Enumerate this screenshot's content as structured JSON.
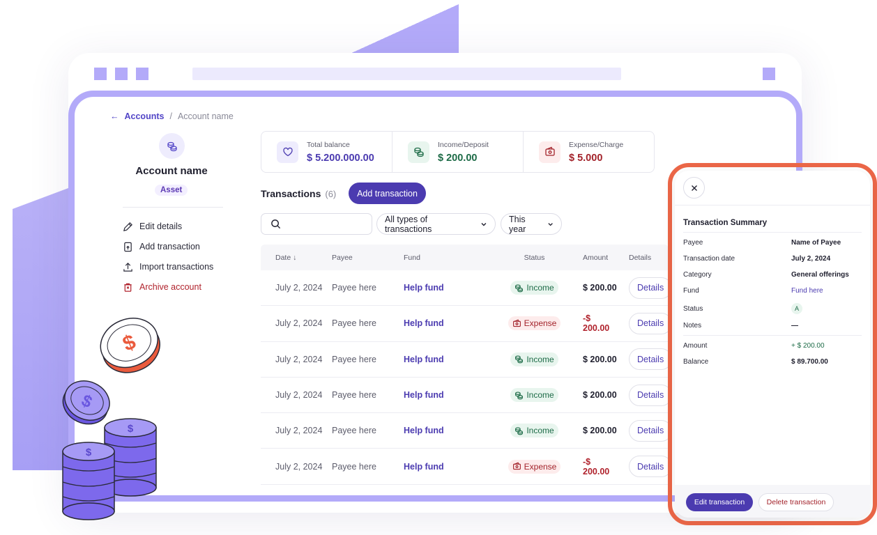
{
  "breadcrumb": {
    "parent": "Accounts",
    "separator": "/",
    "current": "Account name"
  },
  "account": {
    "name": "Account name",
    "type_badge": "Asset",
    "menu": [
      {
        "label": "Edit details",
        "icon": "pencil-icon"
      },
      {
        "label": "Add transaction",
        "icon": "file-plus-icon"
      },
      {
        "label": "Import transactions",
        "icon": "upload-icon"
      },
      {
        "label": "Archive account",
        "icon": "trash-icon"
      }
    ]
  },
  "stats": [
    {
      "label": "Total balance",
      "value": "$ 5.200.000.00",
      "icon": "heart-icon",
      "color": "#4b3bb0"
    },
    {
      "label": "Income/Deposit",
      "value": "$ 200.00",
      "icon": "coins-icon",
      "color": "#1d6b47"
    },
    {
      "label": "Expense/Charge",
      "value": "$ 5.000",
      "icon": "wallet-icon",
      "color": "#a3232b"
    }
  ],
  "transactions": {
    "title": "Transactions",
    "count": "(6)",
    "add_label": "Add transaction",
    "search_placeholder": "",
    "filter_type": "All types of transactions",
    "filter_period": "This year",
    "columns": {
      "date": "Date",
      "payee": "Payee",
      "fund": "Fund",
      "status": "Status",
      "amount": "Amount",
      "details": "Details"
    },
    "rows": [
      {
        "date": "July 2, 2024",
        "payee": "Payee here",
        "fund": "Help fund",
        "status": "Income",
        "amount": "$ 200.00",
        "details": "Details"
      },
      {
        "date": "July 2, 2024",
        "payee": "Payee here",
        "fund": "Help fund",
        "status": "Expense",
        "amount": "-$ 200.00",
        "details": "Details"
      },
      {
        "date": "July 2, 2024",
        "payee": "Payee here",
        "fund": "Help fund",
        "status": "Income",
        "amount": "$ 200.00",
        "details": "Details"
      },
      {
        "date": "July 2, 2024",
        "payee": "Payee here",
        "fund": "Help fund",
        "status": "Income",
        "amount": "$ 200.00",
        "details": "Details"
      },
      {
        "date": "July 2, 2024",
        "payee": "Payee here",
        "fund": "Help fund",
        "status": "Income",
        "amount": "$ 200.00",
        "details": "Details"
      },
      {
        "date": "July 2, 2024",
        "payee": "Payee here",
        "fund": "Help fund",
        "status": "Expense",
        "amount": "-$ 200.00",
        "details": "Details"
      }
    ]
  },
  "summary": {
    "title": "Transaction Summary",
    "fields": [
      {
        "key": "Payee",
        "value": "Name of Payee"
      },
      {
        "key": "Transaction date",
        "value": "July 2, 2024"
      },
      {
        "key": "Category",
        "value": "General offerings"
      },
      {
        "key": "Fund",
        "value": "Fund here"
      },
      {
        "key": "Status",
        "value": "A"
      },
      {
        "key": "Notes",
        "value": "—"
      }
    ],
    "totals": [
      {
        "key": "Amount",
        "value": "+ $ 200.00"
      },
      {
        "key": "Balance",
        "value": "$ 89.700.00"
      }
    ],
    "edit_label": "Edit transaction",
    "delete_label": "Delete transaction"
  },
  "colors": {
    "primary": "#4b3bb0",
    "accent": "#b3aaf9",
    "highlight": "#ec6748",
    "income": "#1d6b47",
    "expense": "#a3232b"
  }
}
